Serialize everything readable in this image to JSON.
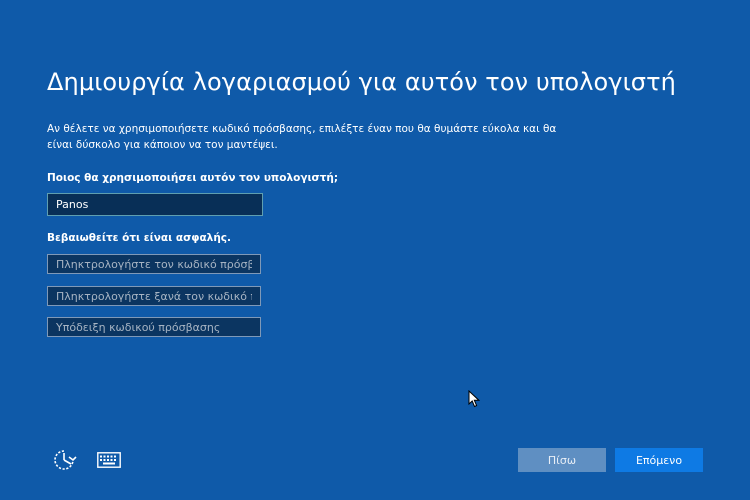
{
  "page": {
    "title": "Δημιουργία λογαριασμού για αυτόν τον υπολογιστή",
    "description": "Αν θέλετε να χρησιμοποιήσετε κωδικό πρόσβασης, επιλέξτε έναν που θα θυμάστε εύκολα και θα είναι δύσκολο για κάποιον να τον μαντέψει."
  },
  "form": {
    "username_label": "Ποιος θα χρησιμοποιήσει αυτόν τον υπολογιστή;",
    "username_value": "Panos",
    "security_label": "Βεβαιωθείτε ότι είναι ασφαλής.",
    "password_placeholder": "Πληκτρολογήστε τον κωδικό πρόσβασης",
    "password_confirm_placeholder": "Πληκτρολογήστε ξανά τον κωδικό πρόσβασης",
    "hint_placeholder": "Υπόδειξη κωδικού πρόσβασης"
  },
  "footer": {
    "accessibility_icon": "ease-of-access-icon",
    "keyboard_icon": "keyboard-icon",
    "back_label": "Πίσω",
    "next_label": "Επόμενο"
  },
  "colors": {
    "background": "#0f5aa9",
    "field_background": "#0b3561",
    "back_button": "#5f8fc2",
    "next_button": "#0e7ae4"
  }
}
